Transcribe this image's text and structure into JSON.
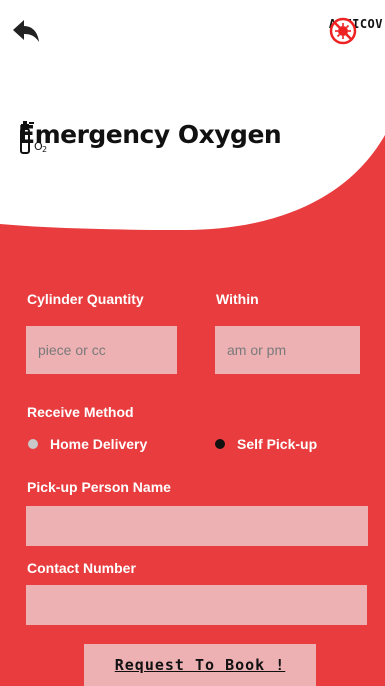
{
  "header": {
    "brand_name": "ANTICOV",
    "title": "Emergency Oxygen",
    "icons": {
      "back": "back-arrow-icon",
      "logo": "virus-prohibited-icon",
      "title": "oxygen-cylinder-icon"
    }
  },
  "form": {
    "cylinder_quantity": {
      "label": "Cylinder Quantity",
      "placeholder": "piece or cc"
    },
    "within": {
      "label": "Within",
      "placeholder": "am or pm"
    },
    "receive_method": {
      "label": "Receive Method",
      "options": [
        {
          "label": "Home Delivery",
          "selected": false
        },
        {
          "label": "Self Pick-up",
          "selected": true
        }
      ]
    },
    "pickup_person_name": {
      "label": "Pick-up Person Name",
      "value": ""
    },
    "contact_number": {
      "label": "Contact Number",
      "value": ""
    },
    "submit_label": "Request To Book !"
  },
  "colors": {
    "background": "#e83c3e",
    "field": "#edb1b4",
    "header": "#ffffff"
  }
}
